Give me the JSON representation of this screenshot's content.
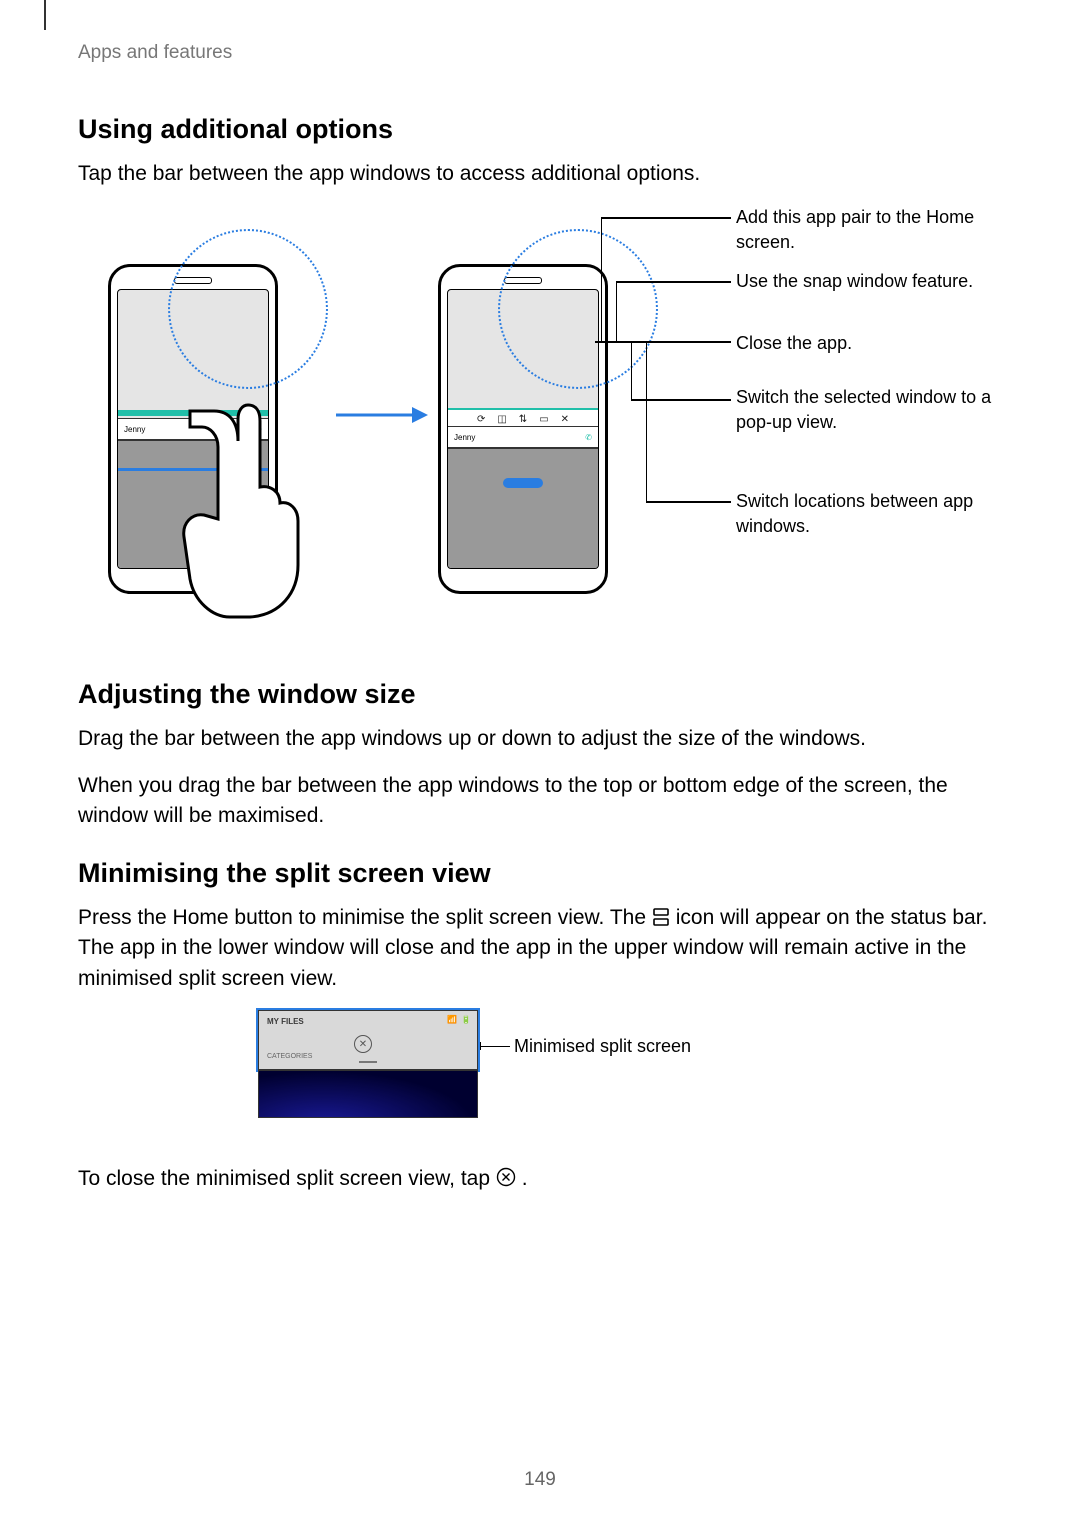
{
  "breadcrumb": "Apps and features",
  "section1_title": "Using additional options",
  "section1_body": "Tap the bar between the app windows to access additional options.",
  "contact_name": "Jenny",
  "fig1_labels": {
    "a": "Add this app pair to the Home screen.",
    "b": "Use the snap window feature.",
    "c": "Close the app.",
    "d": "Switch the selected window to a pop-up view.",
    "e": "Switch locations between app windows."
  },
  "section2_title": "Adjusting the window size",
  "section2_body1": "Drag the bar between the app windows up or down to adjust the size of the windows.",
  "section2_body2": "When you drag the bar between the app windows to the top or bottom edge of the screen, the window will be maximised.",
  "section3_title": "Minimising the split screen view",
  "section3_pre": "Press the Home button to minimise the split screen view. The ",
  "section3_post": " icon will appear on the status bar. The app in the lower window will close and the app in the upper window will remain active in the minimised split screen view.",
  "mini_t1": "MY FILES",
  "mini_t2": "CATEGORIES",
  "mini_label": "Minimised split screen",
  "close_text_pre": "To close the minimised split screen view, tap ",
  "close_text_post": ".",
  "page_number": "149"
}
